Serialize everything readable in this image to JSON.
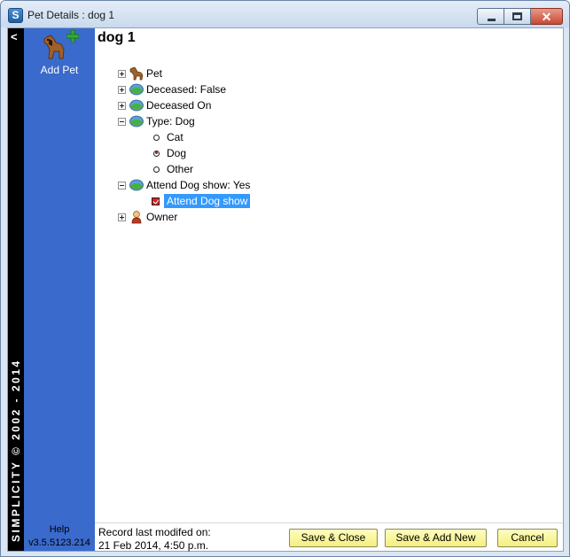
{
  "window": {
    "title": "Pet Details : dog 1",
    "close_symbol": "✕"
  },
  "brand": {
    "text": "SIMPLICITY © 2002 - 2014",
    "collapse_symbol": "<"
  },
  "sidebar": {
    "add_pet_label": "Add Pet",
    "help_label": "Help",
    "version": "v3.5.5123.214"
  },
  "record": {
    "title": "dog 1"
  },
  "tree": {
    "pet": "Pet",
    "deceased": "Deceased:  False",
    "deceased_on": "Deceased On",
    "type": "Type:  Dog",
    "type_options": [
      "Cat",
      "Dog",
      "Other"
    ],
    "type_selected": "Dog",
    "attend_dog_show": "Attend Dog show:  Yes",
    "attend_dog_show_check": "Attend Dog show",
    "owner": "Owner"
  },
  "footer": {
    "modified_label": "Record last modifed on:",
    "modified_value": "21 Feb 2014, 4:50 p.m.",
    "save_close": "Save & Close",
    "save_add_new": "Save & Add New",
    "cancel": "Cancel"
  },
  "colors": {
    "sidebar": "#3a6acb",
    "button": "#f4ee7e",
    "selection": "#3399ff"
  }
}
